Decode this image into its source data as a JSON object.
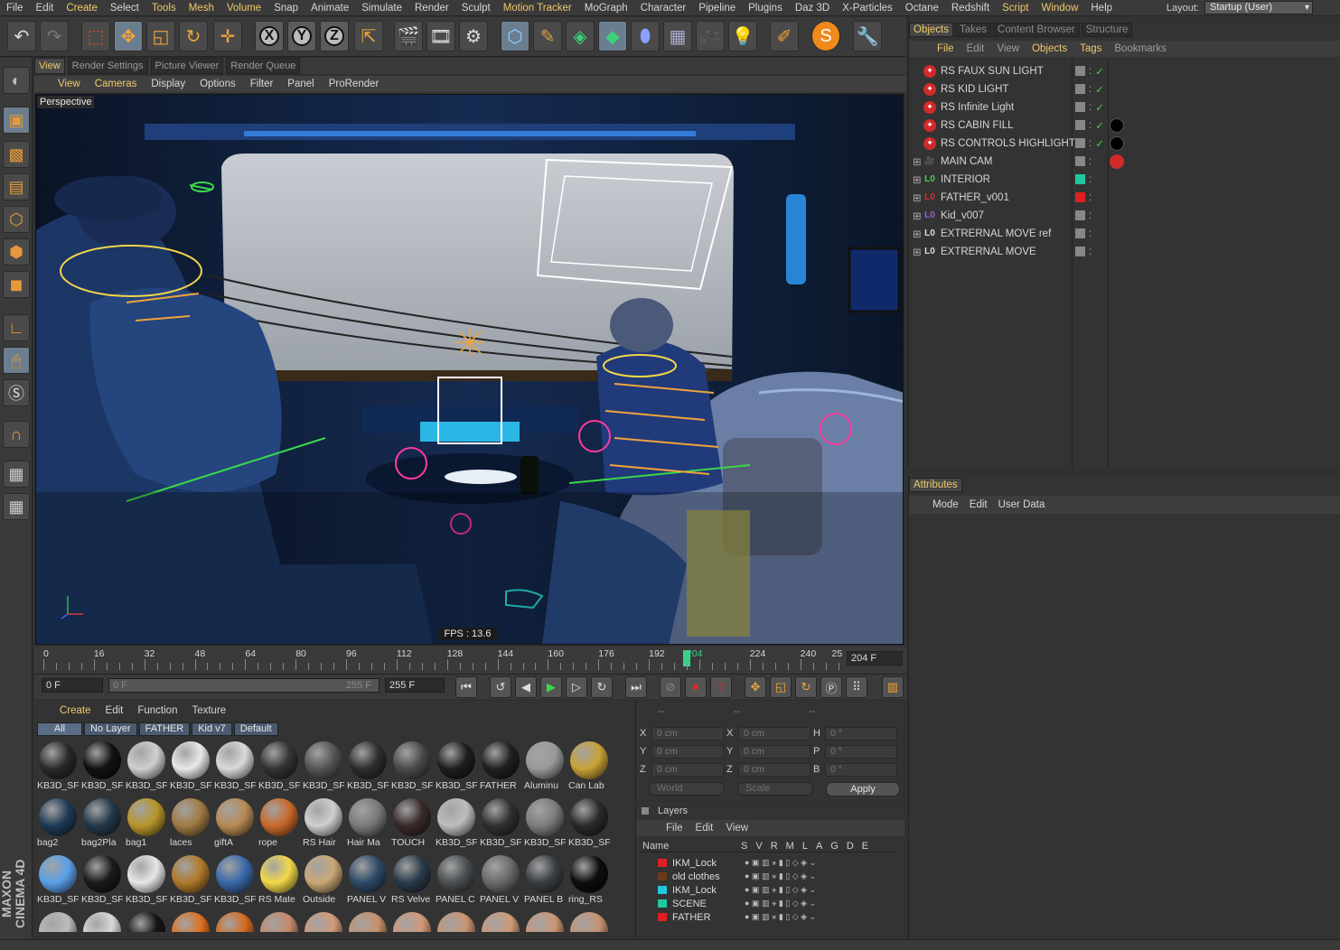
{
  "menu": {
    "items": [
      "File",
      "Edit",
      "Create",
      "Select",
      "Tools",
      "Mesh",
      "Volume",
      "Snap",
      "Animate",
      "Simulate",
      "Render",
      "Sculpt",
      "Motion Tracker",
      "MoGraph",
      "Character",
      "Pipeline",
      "Plugins",
      "Daz 3D",
      "X-Particles",
      "Octane",
      "Redshift",
      "Script",
      "Window",
      "Help"
    ],
    "highlighted": [
      "Create",
      "Tools",
      "Mesh",
      "Volume",
      "Motion Tracker",
      "Script",
      "Window"
    ],
    "layout_label": "Layout:",
    "layout_value": "Startup (User)"
  },
  "viewport": {
    "tabs": [
      "View",
      "Render Settings",
      "Picture Viewer",
      "Render Queue"
    ],
    "active_tab": "View",
    "menu": [
      "View",
      "Cameras",
      "Display",
      "Options",
      "Filter",
      "Panel",
      "ProRender"
    ],
    "highlighted_menu": [
      "View",
      "Cameras"
    ],
    "label": "Perspective",
    "fps": "FPS : 13.6"
  },
  "timeline": {
    "ticks": [
      "0",
      "16",
      "32",
      "48",
      "64",
      "80",
      "96",
      "112",
      "128",
      "144",
      "160",
      "176",
      "192",
      "204",
      "224",
      "240",
      "25"
    ],
    "current_frame": 204,
    "current_frame_text": "204 F",
    "start_field": "0 F",
    "range_start": "0 F",
    "range_end": "255 F",
    "end_field": "255 F"
  },
  "materials": {
    "menu": [
      "Create",
      "Edit",
      "Function",
      "Texture"
    ],
    "highlighted_menu": [
      "Create"
    ],
    "filters": [
      "All",
      "No Layer",
      "FATHER",
      "Kid v7",
      "Default"
    ],
    "items": [
      {
        "name": "KB3D_SF",
        "color": "#2a2a2a"
      },
      {
        "name": "KB3D_SF",
        "color": "#111111"
      },
      {
        "name": "KB3D_SF",
        "color": "#cfcfcf"
      },
      {
        "name": "KB3D_SF",
        "color": "#e8e8e8"
      },
      {
        "name": "KB3D_SF",
        "color": "#d9d9d9"
      },
      {
        "name": "KB3D_SF",
        "color": "#333333"
      },
      {
        "name": "KB3D_SF",
        "color": "#555555"
      },
      {
        "name": "KB3D_SF",
        "color": "#2e2e2e"
      },
      {
        "name": "KB3D_SF",
        "color": "#4a4a4a"
      },
      {
        "name": "KB3D_SF",
        "color": "#1e1e1e"
      },
      {
        "name": "FATHER",
        "color": "#202020"
      },
      {
        "name": "Aluminu",
        "color": "#9a9a9a"
      },
      {
        "name": "Can Lab",
        "color": "#c9a236"
      },
      {
        "name": "bag2",
        "color": "#1f3a55"
      },
      {
        "name": "bag2Pla",
        "color": "#22384a"
      },
      {
        "name": "bag1",
        "color": "#b8952a"
      },
      {
        "name": "laces",
        "color": "#a07a45"
      },
      {
        "name": "giftA",
        "color": "#b88a55"
      },
      {
        "name": "rope",
        "color": "#c9692a"
      },
      {
        "name": "RS Hair",
        "color": "#cfcfcf"
      },
      {
        "name": "Hair Ma",
        "color": "#7a7a7a"
      },
      {
        "name": "TOUCH",
        "color": "#3a2a2a"
      },
      {
        "name": "KB3D_SF",
        "color": "#bdbdbd"
      },
      {
        "name": "KB3D_SF",
        "color": "#303030"
      },
      {
        "name": "KB3D_SF",
        "color": "#7d7d7d"
      },
      {
        "name": "KB3D_SF",
        "color": "#2a2a2a"
      },
      {
        "name": "KB3D_SF",
        "color": "#5aa0e8"
      },
      {
        "name": "KB3D_SF",
        "color": "#1a1a1a"
      },
      {
        "name": "KB3D_SF",
        "color": "#e6e6e6"
      },
      {
        "name": "KB3D_SF",
        "color": "#b07a2a"
      },
      {
        "name": "KB3D_SF",
        "color": "#3a6aaa"
      },
      {
        "name": "RS Mate",
        "color": "#f2d84a"
      },
      {
        "name": "Outside",
        "color": "#c9a876"
      },
      {
        "name": "PANEL V",
        "color": "#2e4a66"
      },
      {
        "name": "RS Velve",
        "color": "#2a3a4a"
      },
      {
        "name": "PANEL C",
        "color": "#4a4f52"
      },
      {
        "name": "PANEL V",
        "color": "#6a6a6a"
      },
      {
        "name": "PANEL B",
        "color": "#3a3e44"
      },
      {
        "name": "ring_RS",
        "color": "#0d0d0d"
      },
      {
        "name": "",
        "color": "#bcbcbc"
      },
      {
        "name": "",
        "color": "#d8d8d8"
      },
      {
        "name": "",
        "color": "#151515"
      },
      {
        "name": "",
        "color": "#e07020"
      },
      {
        "name": "",
        "color": "#d46a20"
      },
      {
        "name": "",
        "color": "#c48a6a"
      },
      {
        "name": "",
        "color": "#d09a7a"
      },
      {
        "name": "",
        "color": "#c8906a"
      },
      {
        "name": "",
        "color": "#d49878"
      },
      {
        "name": "",
        "color": "#c89470"
      },
      {
        "name": "",
        "color": "#cf9a78"
      },
      {
        "name": "",
        "color": "#cc9676"
      },
      {
        "name": "",
        "color": "#c89272"
      }
    ]
  },
  "coords": {
    "headers": [
      "--",
      "--",
      "--"
    ],
    "rows": [
      {
        "l1": "X",
        "v1": "0 cm",
        "l2": "X",
        "v2": "0 cm",
        "l3": "H",
        "v3": "0 °"
      },
      {
        "l1": "Y",
        "v1": "0 cm",
        "l2": "Y",
        "v2": "0 cm",
        "l3": "P",
        "v3": "0 °"
      },
      {
        "l1": "Z",
        "v1": "0 cm",
        "l2": "Z",
        "v2": "0 cm",
        "l3": "B",
        "v3": "0 °"
      }
    ],
    "mode": "World",
    "scale": "Scale",
    "apply": "Apply"
  },
  "layers": {
    "title": "Layers",
    "menu": [
      "File",
      "Edit",
      "View"
    ],
    "col_name": "Name",
    "col_flags": [
      "S",
      "V",
      "R",
      "M",
      "L",
      "A",
      "G",
      "D",
      "E"
    ],
    "rows": [
      {
        "name": "IKM_Lock",
        "color": "#e02020"
      },
      {
        "name": "old clothes",
        "color": "#6a3a1a"
      },
      {
        "name": "IKM_Lock",
        "color": "#20c8e0"
      },
      {
        "name": "SCENE",
        "color": "#20c8a0"
      },
      {
        "name": "FATHER",
        "color": "#e02020"
      }
    ]
  },
  "objects": {
    "tabs": [
      "Objects",
      "Takes",
      "Content Browser",
      "Structure"
    ],
    "active_tab": "Objects",
    "menu": [
      "File",
      "Edit",
      "View",
      "Objects",
      "Tags",
      "Bookmarks"
    ],
    "highlighted_menu": [
      "File",
      "Objects",
      "Tags"
    ],
    "rows": [
      {
        "name": "RS FAUX SUN LIGHT",
        "type": "light"
      },
      {
        "name": "RS KID LIGHT",
        "type": "light"
      },
      {
        "name": "RS Infinite Light",
        "type": "light"
      },
      {
        "name": "RS CABIN FILL",
        "type": "light"
      },
      {
        "name": "RS CONTROLS HIGHLIGHTS",
        "type": "light"
      },
      {
        "name": "MAIN CAM",
        "type": "camera"
      },
      {
        "name": "INTERIOR",
        "type": "null-green"
      },
      {
        "name": "FATHER_v001",
        "type": "null-red"
      },
      {
        "name": "Kid_v007",
        "type": "null-purple"
      },
      {
        "name": "EXTRERNAL MOVE ref",
        "type": "null"
      },
      {
        "name": "EXTRERNAL MOVE",
        "type": "null"
      }
    ]
  },
  "attributes": {
    "tab": "Attributes",
    "menu": [
      "Mode",
      "Edit",
      "User Data"
    ]
  },
  "branding": "MAXON CINEMA 4D",
  "colors": {
    "accent": "#f0c96a",
    "timeline_cursor": "#3bd18a"
  }
}
